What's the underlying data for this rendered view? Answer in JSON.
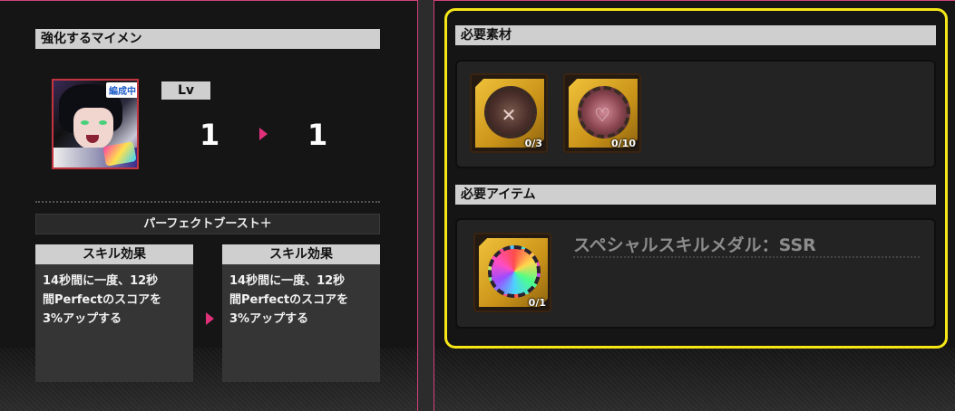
{
  "left": {
    "header": "強化するマイメン",
    "avatar": {
      "team_badge": "編成中",
      "icon": "character-portrait"
    },
    "level": {
      "label": "Lv",
      "current": "1",
      "next": "1"
    },
    "skill_name": "パーフェクトブースト＋",
    "skill_before": {
      "title": "スキル効果",
      "lines": [
        "14秒間に一度、12秒",
        "間Perfectのスコアを",
        "3%アップする"
      ]
    },
    "skill_after": {
      "title": "スキル効果",
      "lines": [
        "14秒間に一度、12秒",
        "間Perfectのスコアを",
        "3%アップする"
      ]
    }
  },
  "right": {
    "materials_header": "必要素材",
    "materials": [
      {
        "icon": "crossed-swords-medal-icon",
        "count": "0/3"
      },
      {
        "icon": "heart-medal-icon",
        "count": "0/10"
      }
    ],
    "items_header": "必要アイテム",
    "item": {
      "icon": "rainbow-medal-icon",
      "name": "スペシャルスキルメダル：SSR",
      "count": "0/1"
    }
  },
  "colors": {
    "accent": "#e0307a",
    "border": "#d0417a",
    "highlight": "#f5e617",
    "header_bg": "#cfcfcf"
  }
}
